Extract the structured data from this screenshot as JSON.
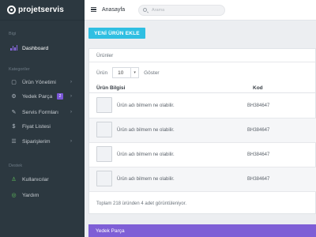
{
  "app": {
    "name": "projetservis"
  },
  "sidebar": {
    "section_main": "Bigi",
    "section_categories": "Kategoriler",
    "section_other": "Destek",
    "items": [
      {
        "label": "Dashboard",
        "icon": "bar-chart-icon"
      },
      {
        "label": "Ürün Yönetimi",
        "icon": "box-icon"
      },
      {
        "label": "Yedek Parça",
        "icon": "gears-icon",
        "badge": "2"
      },
      {
        "label": "Servis Formları",
        "icon": "pencil-icon"
      },
      {
        "label": "Fiyat Listesi",
        "icon": "money-icon"
      },
      {
        "label": "Siparişlerim",
        "icon": "cart-icon"
      },
      {
        "label": "Kullanıcılar",
        "icon": "user-icon"
      },
      {
        "label": "Yardım",
        "icon": "help-icon"
      }
    ],
    "chevron": "›"
  },
  "topbar": {
    "page_title": "Anasayfa",
    "search_placeholder": "Arama"
  },
  "main": {
    "add_button": "YENİ ÜRÜN EKLE",
    "products_card": {
      "title": "Ürünler",
      "show_prefix": "Ürün",
      "page_size": "10",
      "show_suffix": "Göster",
      "columns": {
        "info": "Ürün Bilgisi",
        "code": "Kod"
      },
      "rows": [
        {
          "name": "Ürün adı bilmem ne olabilir.",
          "code": "BH384647"
        },
        {
          "name": "Ürün adı bilmem ne olabilir.",
          "code": "BH384647"
        },
        {
          "name": "Ürün adı bilmem ne olabilir.",
          "code": "BH384647"
        },
        {
          "name": "Ürün adı bilmem ne olabilir.",
          "code": "BH384647"
        }
      ],
      "summary": "Toplam 218 üründen 4 adet görüntüleniyor."
    },
    "bottom_panel_title": "Yedek Parça"
  },
  "colors": {
    "sidebar_bg": "#2c3840",
    "accent_purple": "#7e5fd6",
    "accent_cyan": "#2fbfe2",
    "success_green": "#5fbf5a"
  }
}
